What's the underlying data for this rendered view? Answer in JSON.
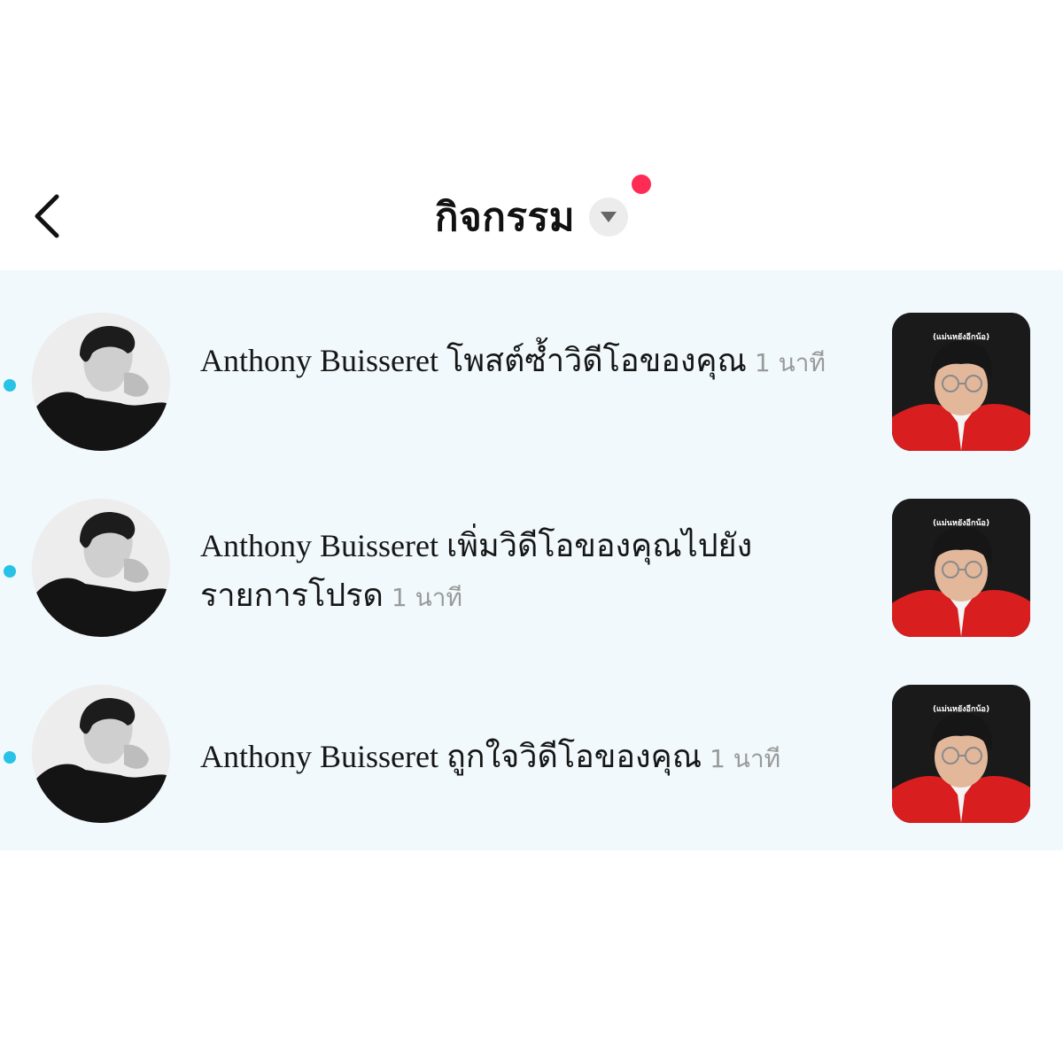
{
  "header": {
    "title": "กิจกรรม",
    "back_icon": "chevron-left-icon",
    "dropdown_icon": "caret-down-icon",
    "notification_dot_color": "#fe2c55"
  },
  "activities": [
    {
      "user": "Anthony Buisseret",
      "action": "โพสต์ซ้ำวิดีโอของคุณ",
      "time": "1 นาที",
      "thumb_caption": "(แม่นหยังอีกน้อ)",
      "unread": true
    },
    {
      "user": "Anthony Buisseret",
      "action": "เพิ่มวิดีโอของคุณไปยังรายการโปรด",
      "time": "1 นาที",
      "thumb_caption": "(แม่นหยังอีกน้อ)",
      "unread": true
    },
    {
      "user": "Anthony Buisseret",
      "action": "ถูกใจวิดีโอของคุณ",
      "time": "1 นาที",
      "thumb_caption": "(แม่นหยังอีกน้อ)",
      "unread": true
    }
  ],
  "colors": {
    "list_background": "#f1f9fd",
    "unread_dot": "#28c2e6",
    "time_text": "#9a9a9a",
    "thumb_shirt": "#d81e1e"
  }
}
